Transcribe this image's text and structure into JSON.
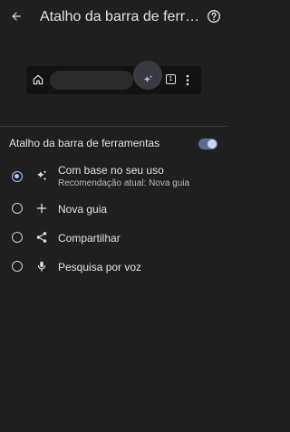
{
  "appbar": {
    "title": "Atalho da barra de ferramentas",
    "back_icon": "arrow-back-icon",
    "help_icon": "help-icon"
  },
  "preview": {
    "home_icon": "home-icon",
    "highlighted_icon": "sparkle-icon",
    "tab_count": "1",
    "menu_icon": "more-vert-icon"
  },
  "toolbar_shortcut": {
    "label": "Atalho da barra de ferramentas",
    "enabled": true
  },
  "options": [
    {
      "label": "Com base no seu uso",
      "sublabel": "Recomendação atual:  Nova guia",
      "icon": "sparkle-icon",
      "selected": true
    },
    {
      "label": "Nova guia",
      "icon": "plus-icon",
      "selected": false
    },
    {
      "label": "Compartilhar",
      "icon": "share-icon",
      "selected": false
    },
    {
      "label": "Pesquisa por voz",
      "icon": "mic-icon",
      "selected": false
    }
  ],
  "colors": {
    "background": "#1f1f1f",
    "accent": "#a8c7fa",
    "text": "#e3e3e3"
  }
}
